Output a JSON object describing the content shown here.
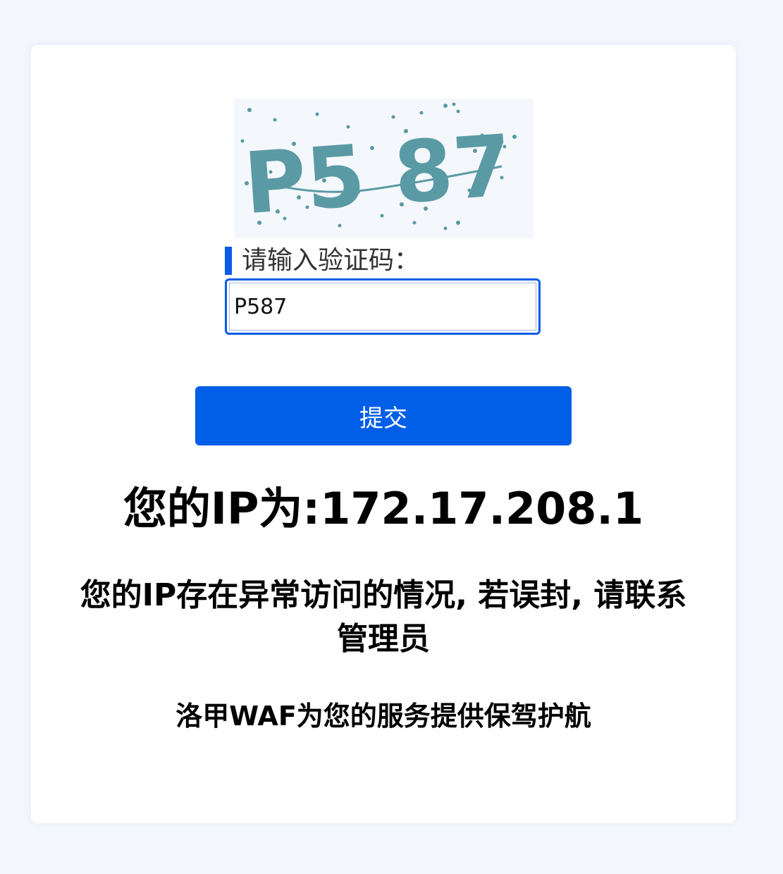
{
  "captcha": {
    "image_text": "P5 87"
  },
  "form": {
    "label": "请输入验证码：",
    "input_value": "P587",
    "submit_label": "提交"
  },
  "info": {
    "ip_line": "您的IP为:172.17.208.1",
    "notice": "您的IP存在异常访问的情况, 若误封, 请联系管理员",
    "footer": "洛甲WAF为您的服务提供保驾护航"
  },
  "colors": {
    "accent": "#005ee7",
    "captcha_text": "#5a9aa4",
    "page_bg": "#f3f7fd"
  }
}
